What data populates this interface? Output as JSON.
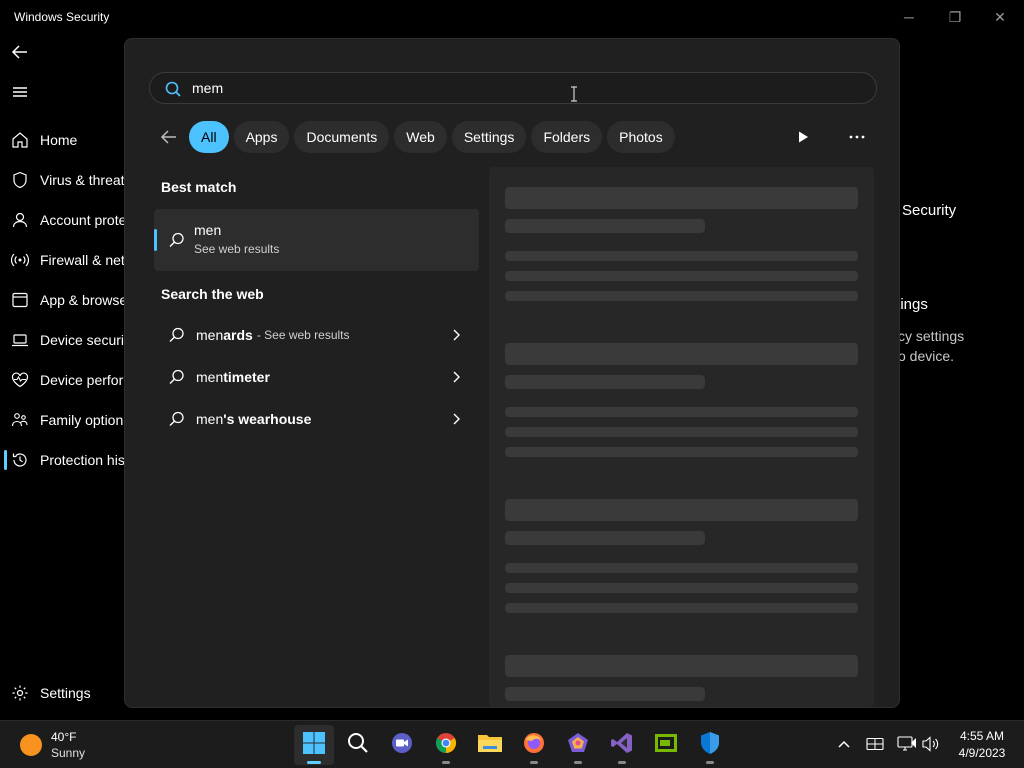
{
  "window": {
    "title": "Windows Security",
    "controls": {
      "minimize": "─",
      "maximize": "❐",
      "close": "✕"
    }
  },
  "sidebar": {
    "items": [
      {
        "label": "Home",
        "icon": "home-icon"
      },
      {
        "label": "Virus & threat",
        "icon": "shield-icon"
      },
      {
        "label": "Account prote",
        "icon": "person-icon"
      },
      {
        "label": "Firewall & net",
        "icon": "wifi-icon"
      },
      {
        "label": "App & browse",
        "icon": "app-window-icon"
      },
      {
        "label": "Device securit",
        "icon": "laptop-icon"
      },
      {
        "label": "Device perfor",
        "icon": "heart-pulse-icon"
      },
      {
        "label": "Family option",
        "icon": "family-icon"
      },
      {
        "label": "Protection his",
        "icon": "history-icon",
        "active": true
      }
    ],
    "settings_label": "Settings"
  },
  "background_text": {
    "line1": "Security",
    "line2": "ttings",
    "line3": "cy settings",
    "line4": "o device."
  },
  "search": {
    "query": "mem",
    "filters": [
      {
        "label": "All",
        "active": true
      },
      {
        "label": "Apps"
      },
      {
        "label": "Documents"
      },
      {
        "label": "Web"
      },
      {
        "label": "Settings"
      },
      {
        "label": "Folders"
      },
      {
        "label": "Photos"
      }
    ],
    "best_match_heading": "Best match",
    "best_match": {
      "title": "men",
      "subtitle": "See web results"
    },
    "web_heading": "Search the web",
    "web_results": [
      {
        "prefix": "men",
        "rest": "ards",
        "suffix": "- See web results"
      },
      {
        "prefix": "men",
        "rest": "timeter",
        "suffix": ""
      },
      {
        "prefix": "men",
        "rest": "'s wearhouse",
        "suffix": ""
      }
    ]
  },
  "taskbar": {
    "weather": {
      "temp": "40°F",
      "condition": "Sunny"
    },
    "apps": [
      "start-icon",
      "search-icon",
      "meet-icon",
      "chrome-icon",
      "file-explorer-icon",
      "firefox-icon",
      "app-icon",
      "visual-studio-icon",
      "nvidia-icon",
      "windows-security-icon"
    ],
    "clock": {
      "time": "4:55 AM",
      "date": "4/9/2023"
    }
  },
  "colors": {
    "accent": "#4cc2ff",
    "panel": "#202020",
    "chip": "#2d2d2d",
    "skeleton": "#3a3a3a"
  }
}
